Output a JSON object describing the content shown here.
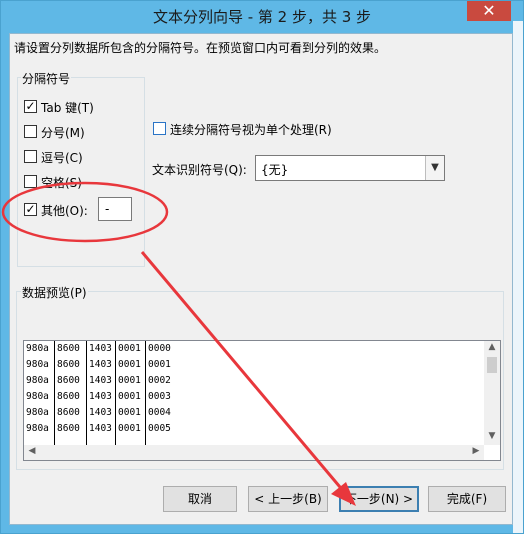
{
  "window": {
    "title": "文本分列向导 - 第 2 步，共 3 步",
    "close_glyph": "✕"
  },
  "instruction": "请设置分列数据所包含的分隔符号。在预览窗口内可看到分列的效果。",
  "delimiters": {
    "legend": "分隔符号",
    "items": [
      {
        "label": "Tab 键(T)",
        "checked": true
      },
      {
        "label": "分号(M)",
        "checked": false
      },
      {
        "label": "逗号(C)",
        "checked": false
      },
      {
        "label": "空格(S)",
        "checked": false
      },
      {
        "label": "其他(O):",
        "checked": true
      }
    ],
    "other_value": "-"
  },
  "options": {
    "treat_consecutive_label": "连续分隔符号视为单个处理(R)",
    "treat_consecutive_checked": false,
    "text_qualifier_label": "文本识别符号(Q):",
    "text_qualifier_value": "{无}"
  },
  "preview": {
    "legend": "数据预览(P)",
    "rows": [
      [
        "980a",
        "8600",
        "1403",
        "0001",
        "0000"
      ],
      [
        "980a",
        "8600",
        "1403",
        "0001",
        "0001"
      ],
      [
        "980a",
        "8600",
        "1403",
        "0001",
        "0002"
      ],
      [
        "980a",
        "8600",
        "1403",
        "0001",
        "0003"
      ],
      [
        "980a",
        "8600",
        "1403",
        "0001",
        "0004"
      ],
      [
        "980a",
        "8600",
        "1403",
        "0001",
        "0005"
      ]
    ]
  },
  "buttons": {
    "cancel": "取消",
    "back": "< 上一步(B)",
    "next": "下一步(N) >",
    "finish": "完成(F)"
  },
  "annotation": {
    "color": "#e8373c"
  },
  "scroll_glyphs": {
    "up": "▲",
    "down": "▼",
    "left": "◀",
    "right": "▶"
  }
}
